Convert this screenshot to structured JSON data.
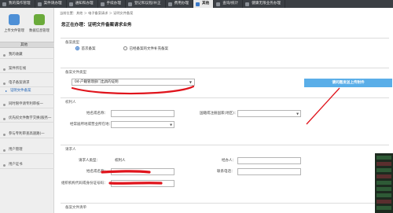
{
  "topnav": {
    "tabs": [
      {
        "label": "我的操作管理"
      },
      {
        "label": "案件请办理"
      },
      {
        "label": "通知和办理"
      },
      {
        "label": "手续办理"
      },
      {
        "label": "登记和议程/补正"
      },
      {
        "label": "费用办理"
      },
      {
        "label": "其他"
      },
      {
        "label": "查询/统计"
      },
      {
        "label": "健康无限业务办理"
      }
    ],
    "active_index": 6
  },
  "sidebar": {
    "top_buttons": [
      {
        "label": "上传文件管理",
        "icon": "upload-cloud-icon"
      },
      {
        "label": "数据信息管理",
        "icon": "data-manage-icon"
      }
    ],
    "section_header": "其他",
    "items": [
      {
        "label": "我的收藏"
      },
      {
        "label": "案件所在线"
      },
      {
        "label": "电子备案请求"
      },
      {
        "label": "证明文件备案"
      },
      {
        "label": "同时限申请专利审核一"
      },
      {
        "label": "优先权文件数字交换(服务一"
      },
      {
        "label": "参与专利审查高速路(一"
      },
      {
        "label": "用户管理"
      },
      {
        "label": "用户证书"
      }
    ],
    "selected_index": 3
  },
  "breadcrumb": "当前位置：其他 ＞ 电子备案请求 ＞ 证明文件备案",
  "page": {
    "title": "您正在办理：证明文件备案请求业务"
  },
  "section_type": {
    "label": "备案类型",
    "options": [
      {
        "label": "首次备案",
        "selected": true
      },
      {
        "label": "已经备案的文件补充备案",
        "selected": false
      }
    ]
  },
  "section_doc": {
    "label": "备案文件类型",
    "select_value": "04-户籍管理部门出具的证明",
    "button": "请问题发送上传附件"
  },
  "section_person": {
    "label": "权利人",
    "name_label": "姓名或名称：",
    "country_label": "国籍或注册国家(地区)：",
    "address_label": "经常居所地或营业所在地："
  },
  "section_requester": {
    "label": "请求人",
    "type_label": "请求人类型：",
    "type_value": "权利人",
    "agent_label": "经办人：",
    "name_label": "姓名或名称：",
    "phone_label": "联系电话：",
    "code_label": "组织机构代码或身份证号码："
  },
  "section_list": {
    "label": "备案文件清单"
  },
  "right_strip": [
    "",
    "",
    "",
    "",
    "",
    "",
    "",
    "",
    ""
  ],
  "colors": {
    "accent": "#5aaee8",
    "annotation": "#e0141c",
    "nav_bg": "#3b3f44"
  }
}
